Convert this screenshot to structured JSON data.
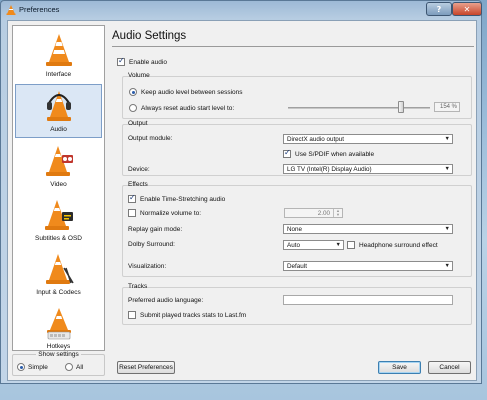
{
  "window": {
    "title": "Preferences",
    "help_label": "?",
    "close_label": "✕"
  },
  "sidebar": {
    "items": [
      {
        "label": "Interface",
        "icon": "vlc-cone-icon"
      },
      {
        "label": "Audio",
        "icon": "headphones-cone-icon"
      },
      {
        "label": "Video",
        "icon": "video-cone-icon"
      },
      {
        "label": "Subtitles & OSD",
        "icon": "subtitles-cone-icon"
      },
      {
        "label": "Input & Codecs",
        "icon": "codecs-cone-icon"
      },
      {
        "label": "Hotkeys",
        "icon": "hotkeys-cone-icon"
      }
    ],
    "selected": "Audio"
  },
  "show_settings": {
    "label": "Show settings",
    "simple": "Simple",
    "all": "All",
    "selected": "Simple"
  },
  "page": {
    "title": "Audio Settings",
    "enable_audio": {
      "label": "Enable audio",
      "checked": true
    }
  },
  "volume": {
    "title": "Volume",
    "keep_label": "Keep audio level between sessions",
    "reset_label": "Always reset audio start level to:",
    "selected": "keep",
    "level": "154 %",
    "level_value": 154
  },
  "output": {
    "title": "Output",
    "module_label": "Output module:",
    "module_value": "DirectX audio output",
    "spdif": {
      "label": "Use S/PDIF when available",
      "checked": true
    },
    "device_label": "Device:",
    "device_value": "LG TV (Intel(R) Display Audio)"
  },
  "effects": {
    "title": "Effects",
    "time_stretch": {
      "label": "Enable Time-Stretching audio",
      "checked": true
    },
    "normalize": {
      "label": "Normalize volume to:",
      "checked": false,
      "value": "2.00"
    },
    "replay_gain_label": "Replay gain mode:",
    "replay_gain_value": "None",
    "dolby_label": "Dolby Surround:",
    "dolby_value": "Auto",
    "headphone": {
      "label": "Headphone surround effect",
      "checked": false
    },
    "visualization_label": "Visualization:",
    "visualization_value": "Default"
  },
  "tracks": {
    "title": "Tracks",
    "language_label": "Preferred audio language:",
    "language_value": "",
    "lastfm": {
      "label": "Submit played tracks stats to Last.fm",
      "checked": false
    }
  },
  "buttons": {
    "reset": "Reset Preferences",
    "save": "Save",
    "cancel": "Cancel"
  },
  "colors": {
    "selection": "#dbe7f5",
    "cone_orange": "#f08a1c",
    "titlebar": "#b7cde2"
  }
}
